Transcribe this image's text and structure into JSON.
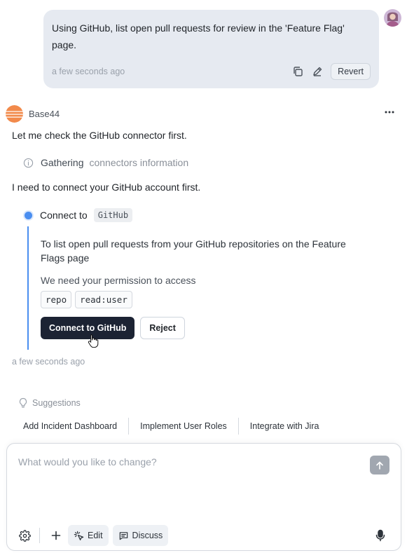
{
  "user_message": {
    "text": "Using GitHub, list open pull requests for review in the 'Feature Flag' page.",
    "timestamp": "a few seconds ago",
    "revert_label": "Revert"
  },
  "assistant": {
    "name": "Base44",
    "intro": "Let me check the GitHub connector first.",
    "gathering": {
      "label": "Gathering",
      "detail": "connectors information"
    },
    "need_connect": "I need to connect your GitHub account first.",
    "connect": {
      "label": "Connect to",
      "service": "GitHub",
      "description": "To list open pull requests from your GitHub repositories on the Feature Flags page",
      "permission_text": "We need your permission to access",
      "scopes": [
        "repo",
        "read:user"
      ],
      "primary_button": "Connect to GitHub",
      "reject_button": "Reject"
    },
    "timestamp": "a few seconds ago"
  },
  "suggestions": {
    "label": "Suggestions",
    "items": [
      "Add Incident Dashboard",
      "Implement User Roles",
      "Integrate with Jira"
    ]
  },
  "composer": {
    "placeholder": "What would you like to change?",
    "edit_label": "Edit",
    "discuss_label": "Discuss"
  },
  "colors": {
    "accent": "#4a8ef0",
    "primary_button": "#1c2333",
    "bubble": "#e6eaf1",
    "brand": "#f28a4b"
  },
  "icons": [
    "copy-icon",
    "pencil-icon",
    "more-icon",
    "info-icon",
    "lightbulb-icon",
    "arrow-up-icon",
    "gear-icon",
    "plus-icon",
    "sparkle-icon",
    "chat-icon",
    "mic-icon",
    "hand-cursor-icon"
  ]
}
